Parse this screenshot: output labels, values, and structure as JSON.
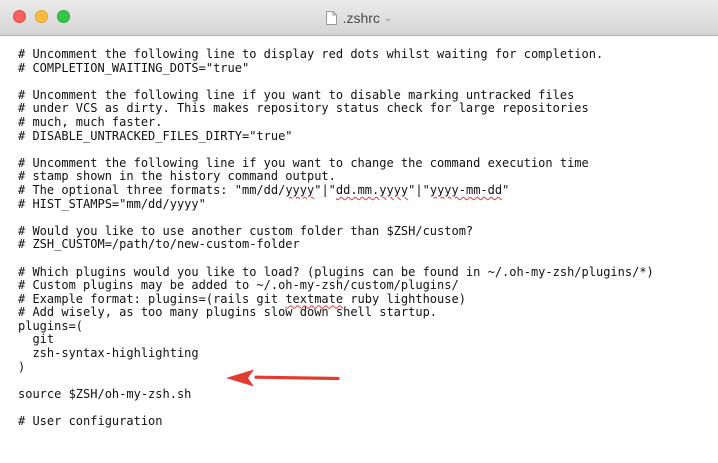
{
  "window": {
    "title": ".zshrc",
    "title_chevron": "⌄",
    "controls": [
      "close",
      "minimize",
      "zoom"
    ]
  },
  "colors": {
    "close": "#fc605c",
    "minimize": "#fdbc40",
    "zoom": "#34c84a",
    "arrow": "#e53a2f",
    "spellcheck_underline": "#e53935"
  },
  "editor": {
    "lines": [
      "# Uncomment the following line to display red dots whilst waiting for completion.",
      "# COMPLETION_WAITING_DOTS=\"true\"",
      "",
      "# Uncomment the following line if you want to disable marking untracked files",
      "# under VCS as dirty. This makes repository status check for large repositories",
      "# much, much faster.",
      "# DISABLE_UNTRACKED_FILES_DIRTY=\"true\"",
      "",
      "# Uncomment the following line if you want to change the command execution time",
      "# stamp shown in the history command output.",
      {
        "segments": [
          {
            "text": "# The optional three formats: \"mm/dd/"
          },
          {
            "text": "yyyy",
            "misspelled": true
          },
          {
            "text": "\"|\""
          },
          {
            "text": "dd.mm.yyyy",
            "misspelled": true
          },
          {
            "text": "\"|\""
          },
          {
            "text": "yyyy-mm-dd",
            "misspelled": true
          },
          {
            "text": "\""
          }
        ]
      },
      "# HIST_STAMPS=\"mm/dd/yyyy\"",
      "",
      "# Would you like to use another custom folder than $ZSH/custom?",
      "# ZSH_CUSTOM=/path/to/new-custom-folder",
      "",
      "# Which plugins would you like to load? (plugins can be found in ~/.oh-my-zsh/plugins/*)",
      "# Custom plugins may be added to ~/.oh-my-zsh/custom/plugins/",
      {
        "segments": [
          {
            "text": "# Example format: plugins=(rails git "
          },
          {
            "text": "textmate",
            "misspelled": true
          },
          {
            "text": " ruby lighthouse)"
          }
        ]
      },
      "# Add wisely, as too many plugins slow down shell startup.",
      "plugins=(",
      "  git",
      "  zsh-syntax-highlighting",
      ")",
      "",
      "source $ZSH/oh-my-zsh.sh",
      "",
      "# User configuration"
    ]
  },
  "annotation": {
    "arrow_target_line": "  zsh-syntax-highlighting",
    "arrow_icon": "red-arrow-left-icon"
  }
}
